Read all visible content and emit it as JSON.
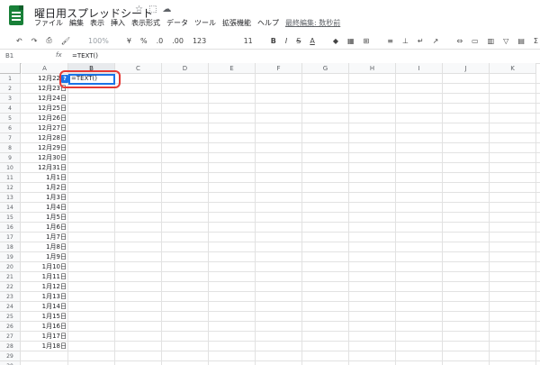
{
  "app": {
    "doc_title": "曜日用スプレッドシート",
    "title_icons": {
      "star": "☆",
      "folder": "⬚",
      "cloud": "☁"
    },
    "menu": [
      "ファイル",
      "編集",
      "表示",
      "挿入",
      "表示形式",
      "データ",
      "ツール",
      "拡張機能",
      "ヘルプ"
    ],
    "last_edit": "最終編集: 数秒前"
  },
  "toolbar": {
    "undo": "↶",
    "redo": "↷",
    "print": "⎙",
    "paint": "🖌",
    "zoom": "100%",
    "currency": "¥",
    "percent": "%",
    "dec_minus": ".0",
    "dec_plus": ".00",
    "format": "123",
    "font": "",
    "font_size": "11",
    "bold": "B",
    "italic": "I",
    "strike": "S",
    "text_color": "A",
    "fill": "◆",
    "borders": "▦",
    "merge": "⊞",
    "halign": "≡",
    "valign": "⊥",
    "wrap": "↵",
    "rotate": "↗",
    "link": "⇔",
    "comment": "▭",
    "chart": "▥",
    "filter": "▽",
    "views": "▤",
    "functions": "Σ"
  },
  "formula_bar": {
    "name_box": "B1",
    "fx": "fx",
    "content": "=TEXT()"
  },
  "grid": {
    "columns": [
      "A",
      "B",
      "C",
      "D",
      "E",
      "F",
      "G",
      "H",
      "I",
      "J",
      "K"
    ],
    "rows": [
      "1",
      "2",
      "3",
      "4",
      "5",
      "6",
      "7",
      "8",
      "9",
      "10",
      "11",
      "12",
      "13",
      "14",
      "15",
      "16",
      "17",
      "18",
      "19",
      "20",
      "21",
      "22",
      "23",
      "24",
      "25",
      "26",
      "27",
      "28",
      "29",
      "30"
    ],
    "colA": [
      "12月22日",
      "12月23日",
      "12月24日",
      "12月25日",
      "12月26日",
      "12月27日",
      "12月28日",
      "12月29日",
      "12月30日",
      "12月31日",
      "1月1日",
      "1月2日",
      "1月3日",
      "1月4日",
      "1月5日",
      "1月6日",
      "1月7日",
      "1月8日",
      "1月9日",
      "1月10日",
      "1月11日",
      "1月12日",
      "1月13日",
      "1月14日",
      "1月15日",
      "1月16日",
      "1月17日",
      "1月18日"
    ],
    "active_cell_text": "=TEXT()",
    "active_cell_badge": "?"
  },
  "colors": {
    "accent": "#1a73e8",
    "highlight": "#e53935",
    "logo": "#188038"
  }
}
